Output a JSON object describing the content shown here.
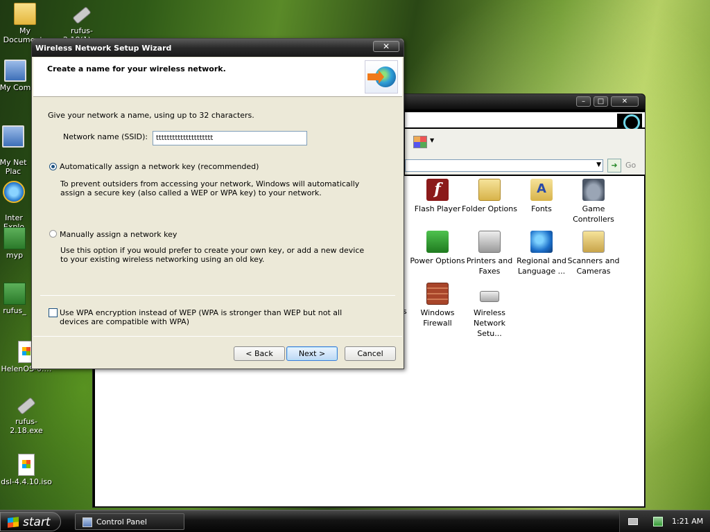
{
  "desktop": {
    "icons": [
      {
        "label": "My Documents",
        "icon": "folder-icon"
      },
      {
        "label": "rufus-2.18(1)....",
        "icon": "usb-drive-icon"
      },
      {
        "label": "My Com",
        "icon": "computer-icon"
      },
      {
        "label": "My Net\nPlac",
        "icon": "network-places-icon"
      },
      {
        "label": "Inter\nExplo",
        "icon": "internet-explorer-icon"
      },
      {
        "label": "myp",
        "icon": "green-book-icon"
      },
      {
        "label": "rufus_",
        "icon": "green-book-icon"
      },
      {
        "label": "HelenOS-0.…",
        "icon": "iso-file-icon"
      },
      {
        "label": "rufus-2.18.exe",
        "icon": "usb-drive-icon"
      },
      {
        "label": "dsl-4.4.10.iso",
        "icon": "iso-file-icon"
      }
    ]
  },
  "control_panel": {
    "go_label": "Go",
    "items": [
      {
        "label": "Flash Player",
        "icon": "flash-icon",
        "glyph": "f"
      },
      {
        "label": "Folder Options",
        "icon": "folder-options-icon"
      },
      {
        "label": "Fonts",
        "icon": "fonts-icon",
        "glyph": "A"
      },
      {
        "label": "Game Controllers",
        "icon": "game-controller-icon"
      },
      {
        "label": "Power Options",
        "icon": "power-icon"
      },
      {
        "label": "Printers and Faxes",
        "icon": "printer-icon"
      },
      {
        "label": "Regional and Language ...",
        "icon": "globe-clock-icon"
      },
      {
        "label": "Scanners and Cameras",
        "icon": "scanner-icon"
      },
      {
        "label": "Windows Firewall",
        "icon": "firewall-icon"
      },
      {
        "label": "Wireless Network Setu...",
        "icon": "wireless-icon"
      }
    ],
    "partial_left_text": "s"
  },
  "wizard": {
    "title": "Wireless Network Setup Wizard",
    "close_glyph": "✕",
    "heading": "Create a name for your wireless network.",
    "intro": "Give your network a name, using up to 32 characters.",
    "ssid_label": "Network name (SSID):",
    "ssid_value": "ttttttttttttttttttttt",
    "option_auto": {
      "label": "Automatically assign a network key (recommended)",
      "description": "To prevent outsiders from accessing your network, Windows will automatically assign a secure key (also called a WEP or WPA key) to your network.",
      "selected": true
    },
    "option_manual": {
      "label": "Manually assign a network key",
      "description": "Use this option if you would prefer to create your own key, or add a new device to your existing wireless networking using an old key.",
      "selected": false
    },
    "wpa_checkbox": {
      "label": "Use WPA encryption instead of WEP (WPA is stronger than WEP but not all devices are compatible with WPA)",
      "checked": false
    },
    "buttons": {
      "back": "< Back",
      "next": "Next >",
      "cancel": "Cancel"
    }
  },
  "taskbar": {
    "start_label": "start",
    "task_label": "Control Panel",
    "clock": "1:21 AM"
  }
}
